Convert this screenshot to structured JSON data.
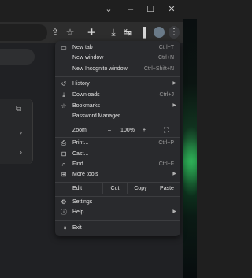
{
  "window": {
    "controls": {
      "dropdown": "⌄",
      "minimize": "–",
      "maximize": "☐",
      "close": "✕"
    }
  },
  "toolbar": {
    "icons": [
      "share-icon",
      "star-icon",
      "extensions-icon",
      "download-icon",
      "tab-search-icon",
      "side-panel-icon",
      "profile-avatar",
      "menu-icon"
    ]
  },
  "menu": {
    "new_tab": {
      "label": "New tab",
      "shortcut": "Ctrl+T"
    },
    "new_window": {
      "label": "New window",
      "shortcut": "Ctrl+N"
    },
    "new_incognito": {
      "label": "New Incognito window",
      "shortcut": "Ctrl+Shift+N"
    },
    "history": {
      "label": "History"
    },
    "downloads": {
      "label": "Downloads",
      "shortcut": "Ctrl+J"
    },
    "bookmarks": {
      "label": "Bookmarks"
    },
    "password_manager": {
      "label": "Password Manager"
    },
    "zoom": {
      "label": "Zoom",
      "minus": "–",
      "value": "100%",
      "plus": "+"
    },
    "print": {
      "label": "Print...",
      "shortcut": "Ctrl+P"
    },
    "cast": {
      "label": "Cast..."
    },
    "find": {
      "label": "Find...",
      "shortcut": "Ctrl+F"
    },
    "more_tools": {
      "label": "More tools"
    },
    "edit": {
      "label": "Edit",
      "cut": "Cut",
      "copy": "Copy",
      "paste": "Paste"
    },
    "settings": {
      "label": "Settings"
    },
    "help": {
      "label": "Help"
    },
    "exit": {
      "label": "Exit"
    }
  }
}
